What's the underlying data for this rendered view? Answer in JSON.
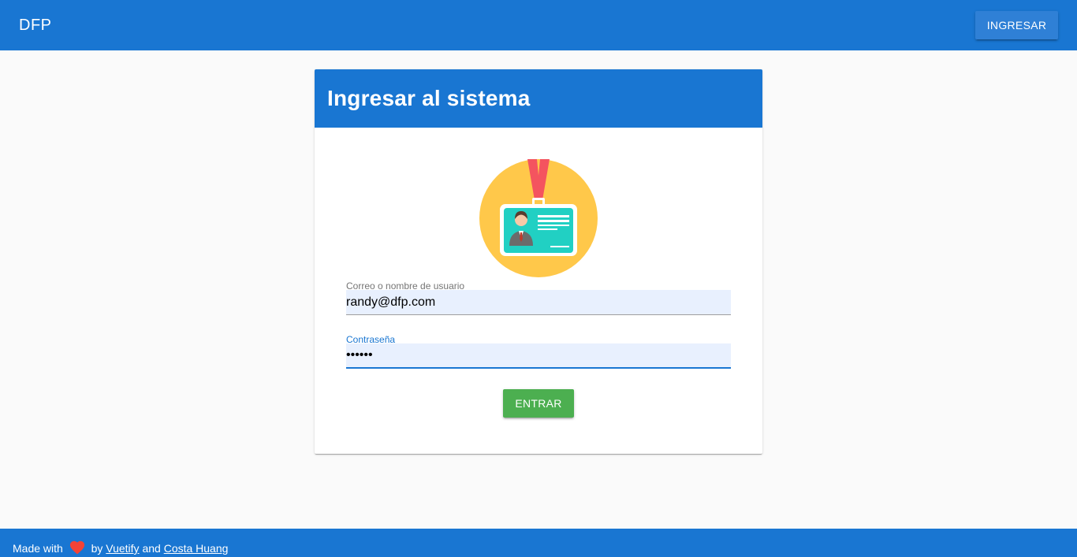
{
  "app": {
    "title": "DFP",
    "login_button": "INGRESAR"
  },
  "login_card": {
    "title": "Ingresar al sistema",
    "illustration": "id-badge-icon",
    "username": {
      "label": "Correo o nombre de usuario",
      "value": "randy@dfp.com"
    },
    "password": {
      "label": "Contraseña",
      "value": "••••••"
    },
    "submit_label": "ENTRAR"
  },
  "footer": {
    "made_with": "Made with",
    "heart_icon": "heart-icon",
    "by": "by",
    "link1": "Vuetify",
    "and": "and",
    "link2": "Costa Huang"
  },
  "colors": {
    "primary": "#1976d2",
    "success": "#4caf50",
    "heart": "#f44336",
    "input_fill": "#e8f0fe"
  }
}
